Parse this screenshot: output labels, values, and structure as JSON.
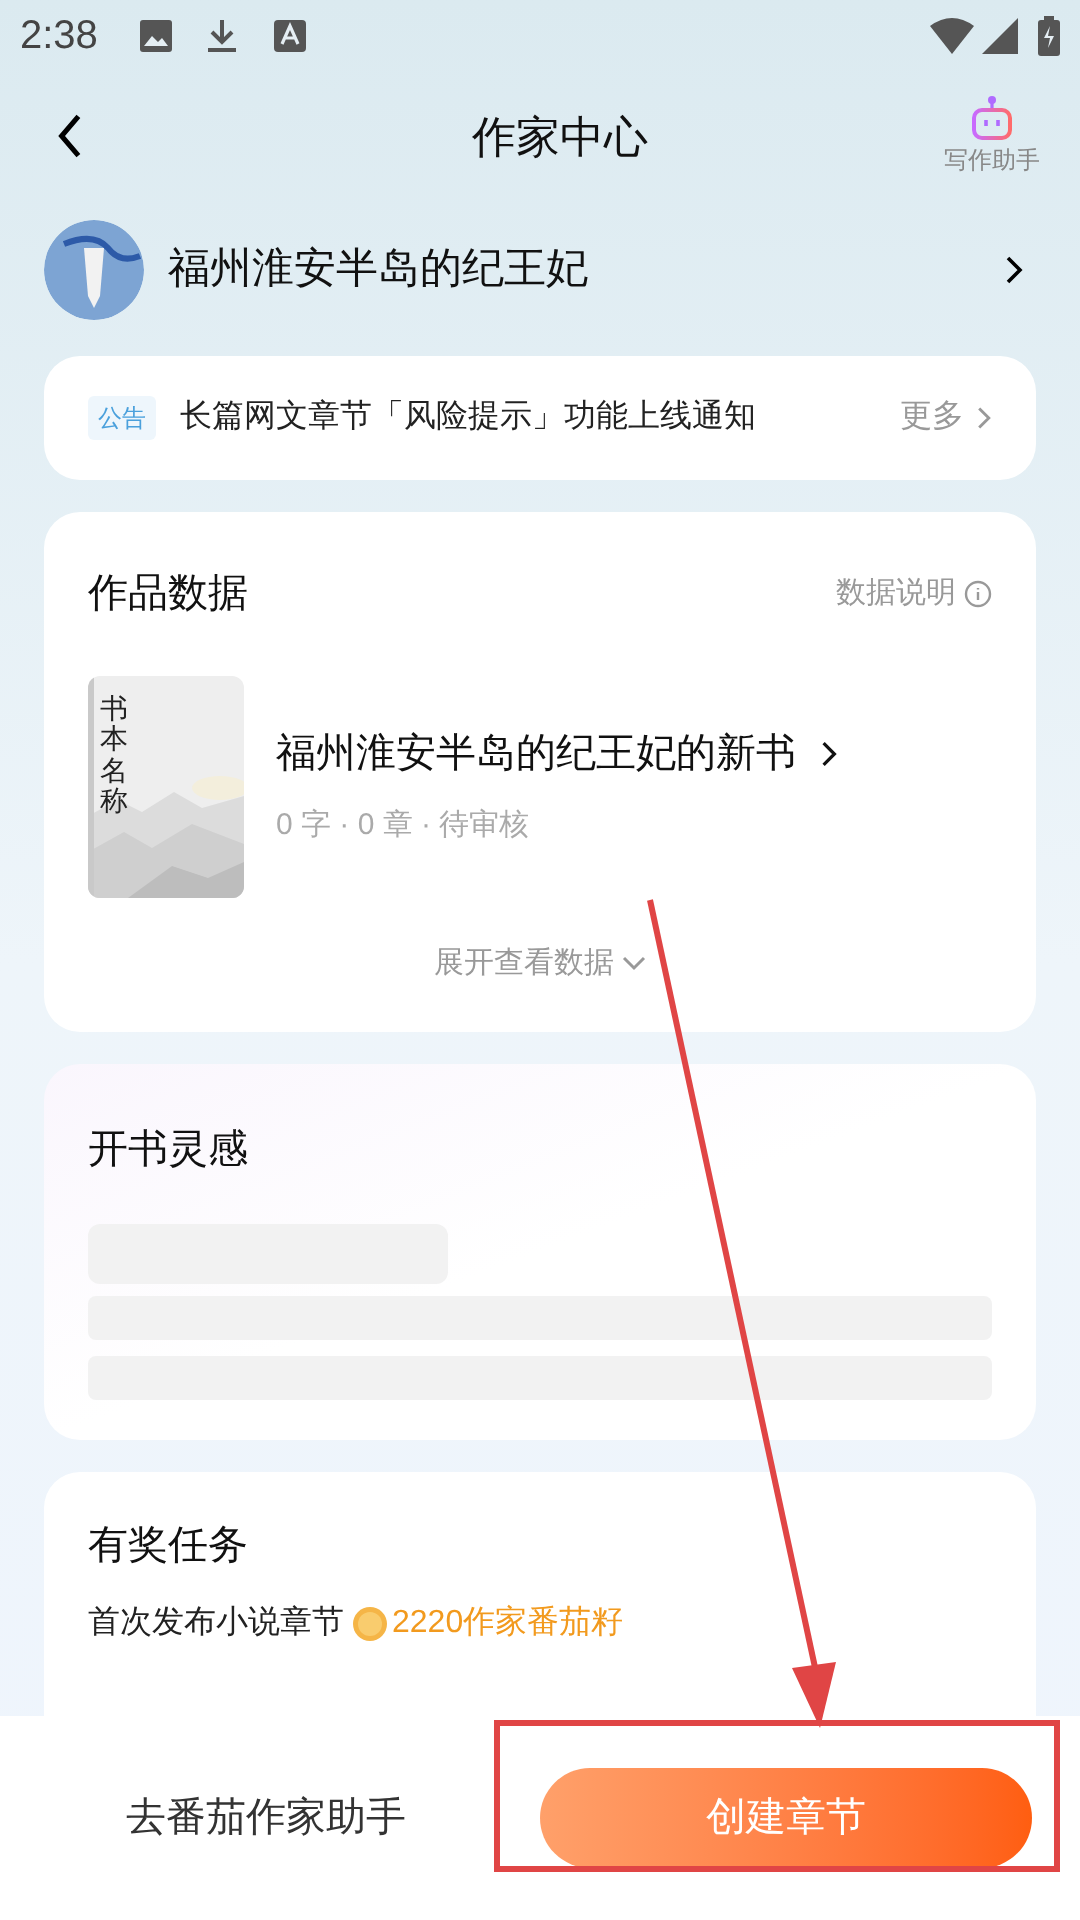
{
  "status_bar": {
    "time": "2:38"
  },
  "header": {
    "title": "作家中心",
    "assistant_label": "写作助手"
  },
  "profile": {
    "name": "福州淮安半岛的纪王妃"
  },
  "notice": {
    "tag": "公告",
    "text": "长篇网文章节「风险提示」功能上线通知",
    "more": "更多"
  },
  "works": {
    "title": "作品数据",
    "help": "数据说明",
    "book": {
      "cover_text": "书本名称",
      "title": "福州淮安半岛的纪王妃的新书",
      "meta": "0 字 · 0 章 · 待审核"
    },
    "expand": "展开查看数据"
  },
  "inspiration": {
    "title": "开书灵感"
  },
  "tasks": {
    "title": "有奖任务",
    "item": {
      "text": "首次发布小说章节",
      "reward": "2220作家番茄籽"
    }
  },
  "bottom_bar": {
    "secondary": "去番茄作家助手",
    "primary": "创建章节"
  }
}
